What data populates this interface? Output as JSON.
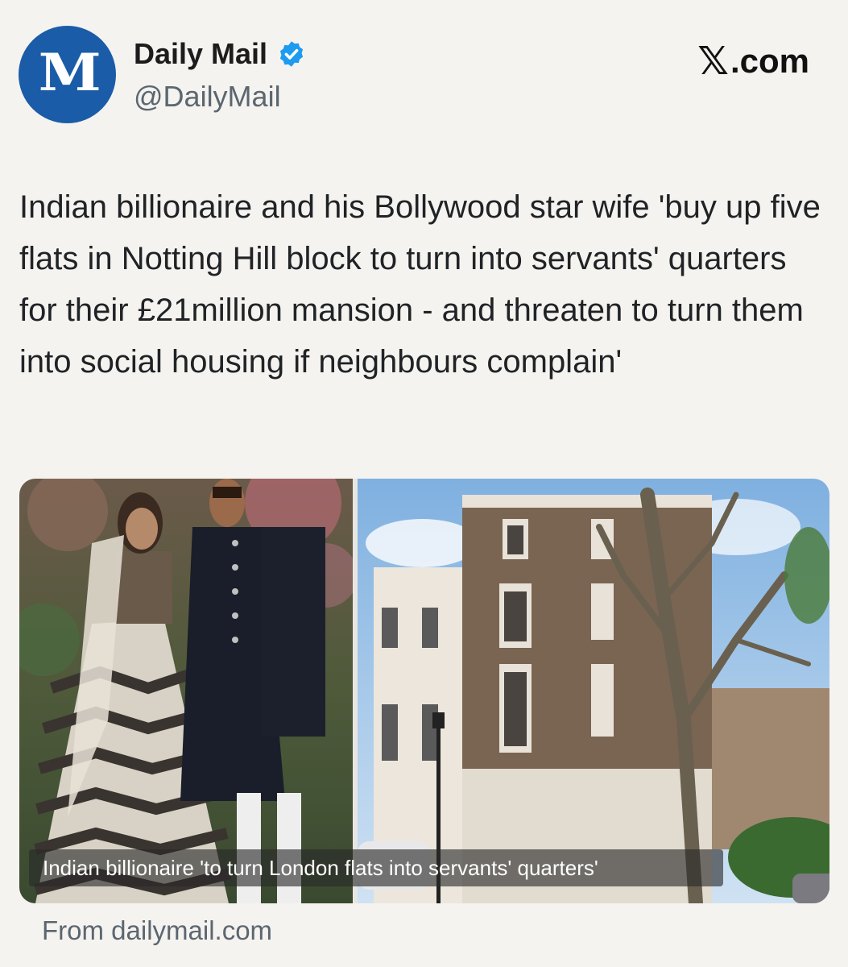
{
  "account": {
    "name": "Daily Mail",
    "handle": "@DailyMail",
    "avatar_text": "M",
    "verified_icon": "verified-badge-icon"
  },
  "brand": {
    "logo_letter": "𝕏",
    "domain_text": ".com"
  },
  "tweet": {
    "text": "Indian billionaire and his Bollywood star wife 'buy up five flats in Notting Hill block to turn into servants' quarters for their £21million mansion - and threaten to turn them into social housing if neighbours complain'"
  },
  "media": {
    "caption": "Indian billionaire 'to turn London flats into servants' quarters'"
  },
  "source": {
    "text": "From dailymail.com"
  },
  "colors": {
    "avatar_bg": "#1a5ca8",
    "verified": "#1d9bf0",
    "background": "#f5f3ef",
    "muted_text": "#5b6670"
  }
}
